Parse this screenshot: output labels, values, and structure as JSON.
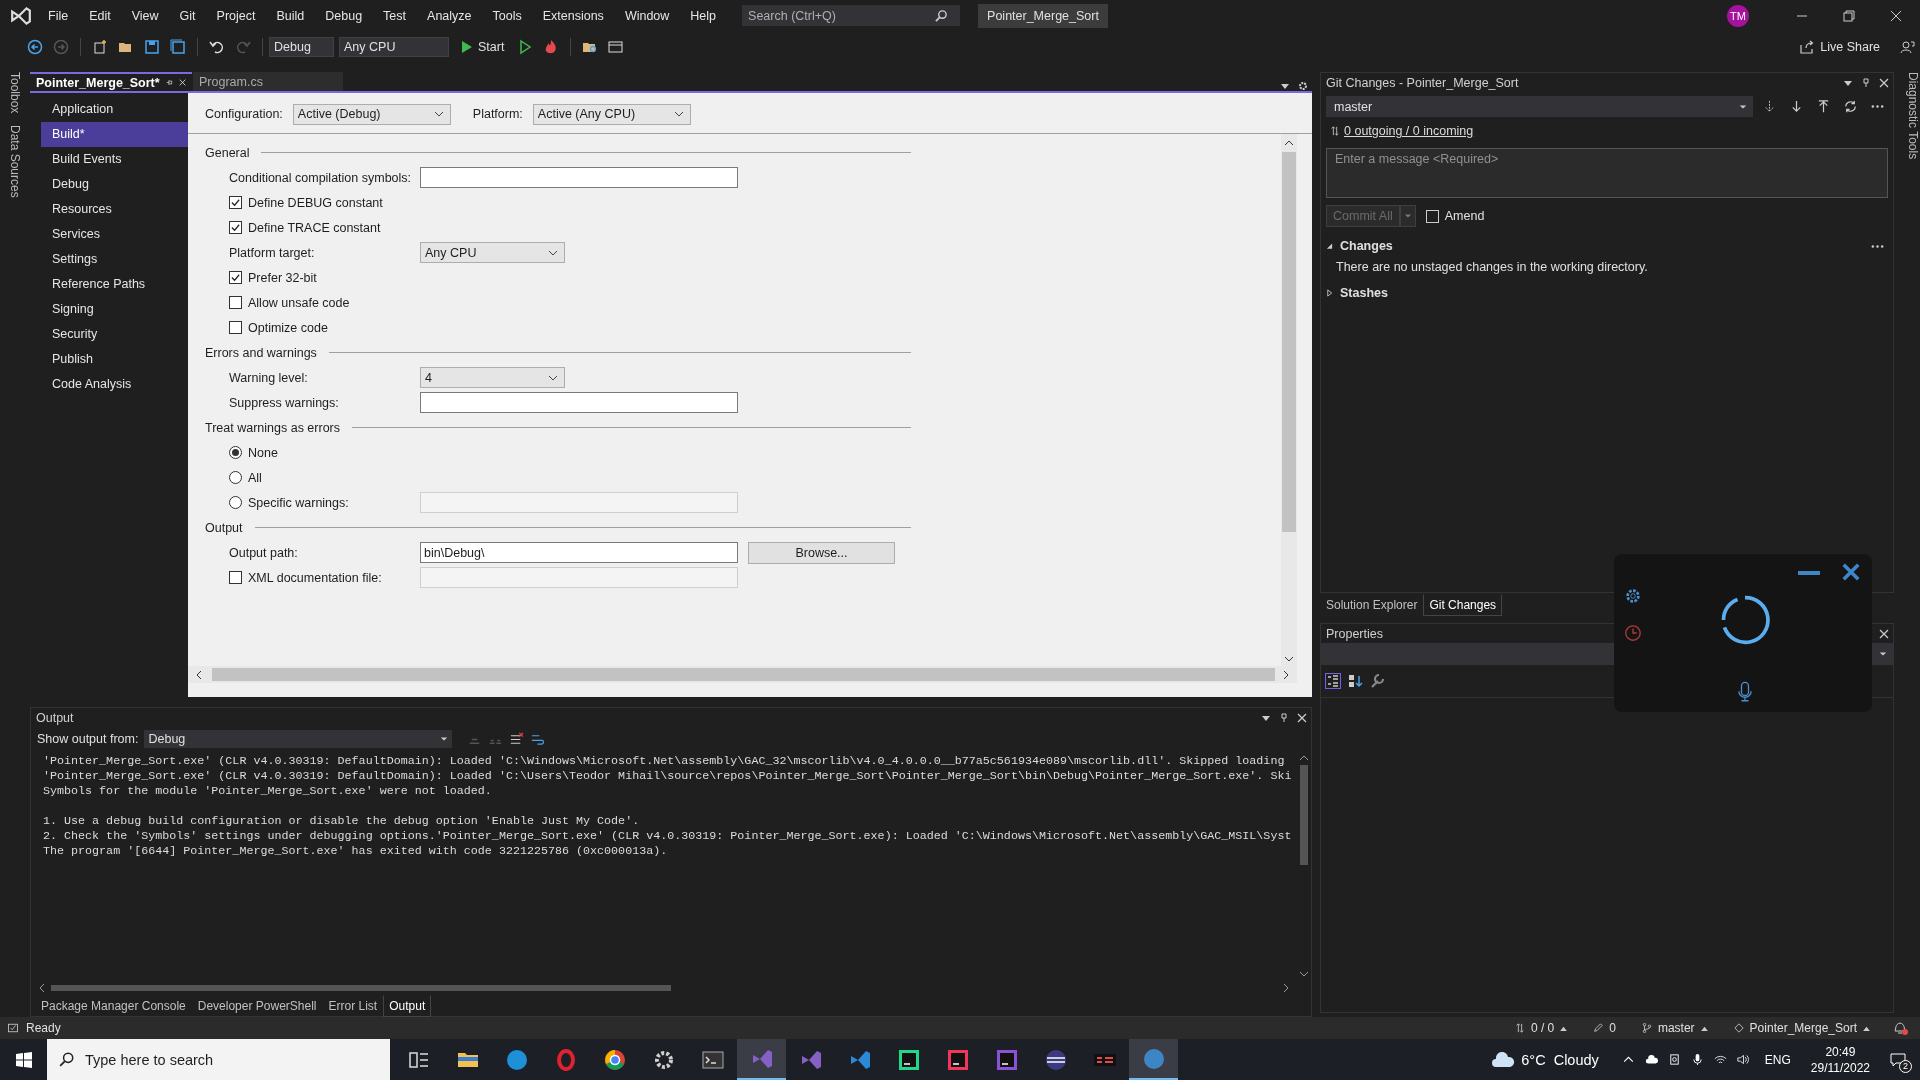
{
  "menu": [
    "File",
    "Edit",
    "View",
    "Git",
    "Project",
    "Build",
    "Debug",
    "Test",
    "Analyze",
    "Tools",
    "Extensions",
    "Window",
    "Help"
  ],
  "search": {
    "placeholder": "Search (Ctrl+Q)"
  },
  "solution_name": "Pointer_Merge_Sort",
  "avatar": "TM",
  "toolbar": {
    "configuration": "Debug",
    "platform": "Any CPU",
    "start": "Start"
  },
  "live_share": "Live Share",
  "side_tabs_left": [
    "Toolbox",
    "Data Sources"
  ],
  "side_tabs_right": [
    "Diagnostic Tools"
  ],
  "doc_tabs": [
    {
      "label": "Pointer_Merge_Sort*",
      "selected": true
    },
    {
      "label": "Program.cs",
      "selected": false
    }
  ],
  "nav": [
    {
      "label": "Application",
      "selected": false
    },
    {
      "label": "Build*",
      "selected": true
    },
    {
      "label": "Build Events",
      "selected": false
    },
    {
      "label": "Debug",
      "selected": false
    },
    {
      "label": "Resources",
      "selected": false
    },
    {
      "label": "Services",
      "selected": false
    },
    {
      "label": "Settings",
      "selected": false
    },
    {
      "label": "Reference Paths",
      "selected": false
    },
    {
      "label": "Signing",
      "selected": false
    },
    {
      "label": "Security",
      "selected": false
    },
    {
      "label": "Publish",
      "selected": false
    },
    {
      "label": "Code Analysis",
      "selected": false
    }
  ],
  "build": {
    "configuration_label": "Configuration:",
    "configuration": "Active (Debug)",
    "platform_label": "Platform:",
    "platform": "Active (Any CPU)",
    "sections": [
      {
        "title": "General",
        "rows": [
          {
            "kind": "text",
            "label": "Conditional compilation symbols:",
            "disabled": false
          },
          {
            "kind": "checkbox",
            "label": "Define DEBUG constant",
            "checked": true
          },
          {
            "kind": "checkbox",
            "label": "Define TRACE constant",
            "checked": true
          },
          {
            "kind": "select",
            "label": "Platform target:",
            "value": "Any CPU"
          },
          {
            "kind": "checkbox",
            "label": "Prefer 32-bit",
            "checked": true
          },
          {
            "kind": "checkbox",
            "label": "Allow unsafe code",
            "checked": false
          },
          {
            "kind": "checkbox",
            "label": "Optimize code",
            "checked": false
          }
        ]
      },
      {
        "title": "Errors and warnings",
        "rows": [
          {
            "kind": "select",
            "label": "Warning level:",
            "value": "4"
          },
          {
            "kind": "text",
            "label": "Suppress warnings:",
            "disabled": false
          }
        ]
      },
      {
        "title": "Treat warnings as errors",
        "rows": [
          {
            "kind": "radio",
            "label": "None",
            "selected": true
          },
          {
            "kind": "radio",
            "label": "All",
            "selected": false
          },
          {
            "kind": "radio",
            "label": "Specific warnings:",
            "selected": false,
            "field": {
              "disabled": true
            }
          }
        ]
      },
      {
        "title": "Output",
        "rows": [
          {
            "kind": "text",
            "label": "Output path:",
            "value": "bin\\Debug\\",
            "disabled": false,
            "button": "Browse..."
          },
          {
            "kind": "checkbox",
            "label": "XML documentation file:",
            "checked": false,
            "field": {
              "disabled": true
            }
          }
        ]
      }
    ]
  },
  "output": {
    "title": "Output",
    "source_label": "Show output from:",
    "source": "Debug",
    "paragraphs": [
      {
        "lines": [
          "'Pointer_Merge_Sort.exe' (CLR v4.0.30319: DefaultDomain): Loaded 'C:\\Windows\\Microsoft.Net\\assembly\\GAC_32\\mscorlib\\v4.0_4.0.0.0__b77a5c561934e089\\mscorlib.dll'. Skipped loading",
          "'Pointer_Merge_Sort.exe' (CLR v4.0.30319: DefaultDomain): Loaded 'C:\\Users\\Teodor Mihail\\source\\repos\\Pointer_Merge_Sort\\Pointer_Merge_Sort\\bin\\Debug\\Pointer_Merge_Sort.exe'. Ski",
          "Symbols for the module 'Pointer_Merge_Sort.exe' were not loaded."
        ]
      },
      {
        "lines": [
          "1. Use a debug build configuration or disable the debug option 'Enable Just My Code'.",
          "2. Check the 'Symbols' settings under debugging options.'Pointer_Merge_Sort.exe' (CLR v4.0.30319: Pointer_Merge_Sort.exe): Loaded 'C:\\Windows\\Microsoft.Net\\assembly\\GAC_MSIL\\Syst",
          "The program '[6644] Pointer_Merge_Sort.exe' has exited with code 3221225786 (0xc000013a)."
        ]
      }
    ]
  },
  "bottom_tabs": [
    {
      "label": "Package Manager Console",
      "selected": false
    },
    {
      "label": "Developer PowerShell",
      "selected": false
    },
    {
      "label": "Error List",
      "selected": false
    },
    {
      "label": "Output",
      "selected": true
    }
  ],
  "git": {
    "title": "Git Changes - Pointer_Merge_Sort",
    "branch": "master",
    "sync_link": "0 outgoing / 0 incoming",
    "message_placeholder": "Enter a message <Required>",
    "commit": {
      "label": "Commit All",
      "disabled": true
    },
    "amend": {
      "label": "Amend",
      "checked": false
    },
    "groups": [
      {
        "title": "Changes",
        "expanded": true,
        "message": "There are no unstaged changes in the working directory."
      },
      {
        "title": "Stashes",
        "expanded": false
      }
    ]
  },
  "right_tabs": [
    {
      "label": "Solution Explorer",
      "selected": false
    },
    {
      "label": "Git Changes",
      "selected": true
    }
  ],
  "properties": {
    "title": "Properties"
  },
  "status_bar": {
    "text": "Ready",
    "sync": "0 / 0",
    "edits": "0",
    "branch": "master",
    "repo": "Pointer_Merge_Sort"
  },
  "taskbar": {
    "search_placeholder": "Type here to search",
    "apps": [
      {
        "kind": "task_view",
        "selected": false
      },
      {
        "kind": "folder",
        "selected": false
      },
      {
        "kind": "edge",
        "selected": false
      },
      {
        "kind": "opera",
        "selected": false
      },
      {
        "kind": "chrome",
        "selected": false
      },
      {
        "kind": "gear",
        "selected": false
      },
      {
        "kind": "terminal",
        "selected": false
      },
      {
        "kind": "vs",
        "selected": true
      },
      {
        "kind": "vs",
        "selected": false
      },
      {
        "kind": "vscode",
        "selected": false
      },
      {
        "kind": "pycharm",
        "selected": false
      },
      {
        "kind": "intellij",
        "selected": false
      },
      {
        "kind": "dotpeek",
        "selected": false
      },
      {
        "kind": "eclipse",
        "selected": false
      },
      {
        "kind": "media",
        "selected": false
      },
      {
        "kind": "app",
        "selected": true
      }
    ],
    "weather": "6°C  Cloudy",
    "language": "ENG",
    "time": "20:49",
    "date": "29/11/2022",
    "notifications": "2"
  }
}
